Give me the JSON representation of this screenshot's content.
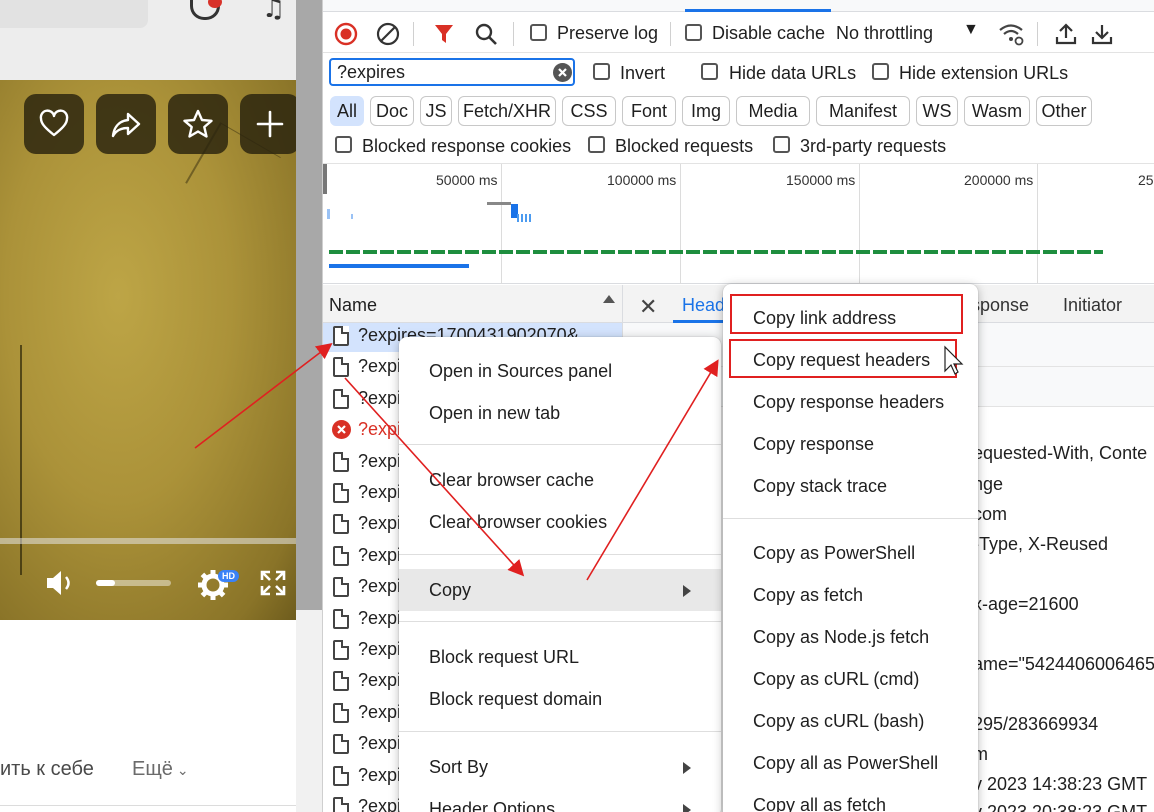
{
  "page": {
    "save_text": "ить к себе",
    "more_text": "Ещё",
    "video_quality_badge": "HD",
    "volume_fraction": 0.25
  },
  "devtools": {
    "toolbar": {
      "preserve_log": "Preserve log",
      "disable_cache": "Disable cache",
      "throttling": "No throttling"
    },
    "filter": {
      "value": "?expires",
      "invert": "Invert",
      "hide_data_urls": "Hide data URLs",
      "hide_extension_urls": "Hide extension URLs"
    },
    "type_filters": [
      "All",
      "Doc",
      "JS",
      "Fetch/XHR",
      "CSS",
      "Font",
      "Img",
      "Media",
      "Manifest",
      "WS",
      "Wasm",
      "Other"
    ],
    "block_filters": {
      "blocked_response_cookies": "Blocked response cookies",
      "blocked_requests": "Blocked requests",
      "third_party": "3rd-party requests"
    },
    "overview_ticks": [
      "50000 ms",
      "100000 ms",
      "150000 ms",
      "200000 ms",
      "25"
    ],
    "name_column": "Name",
    "requests": [
      {
        "name": "?expires=1700431902070&",
        "selected": true,
        "error": false
      },
      {
        "name": "?expir",
        "selected": false,
        "error": false
      },
      {
        "name": "?expir",
        "selected": false,
        "error": false
      },
      {
        "name": "?expir",
        "selected": false,
        "error": true
      },
      {
        "name": "?expir",
        "selected": false,
        "error": false
      },
      {
        "name": "?expir",
        "selected": false,
        "error": false
      },
      {
        "name": "?expir",
        "selected": false,
        "error": false
      },
      {
        "name": "?expir",
        "selected": false,
        "error": false
      },
      {
        "name": "?expir",
        "selected": false,
        "error": false
      },
      {
        "name": "?expir",
        "selected": false,
        "error": false
      },
      {
        "name": "?expir",
        "selected": false,
        "error": false
      },
      {
        "name": "?expir",
        "selected": false,
        "error": false
      },
      {
        "name": "?expir",
        "selected": false,
        "error": false
      },
      {
        "name": "?expir",
        "selected": false,
        "error": false
      },
      {
        "name": "?expir",
        "selected": false,
        "error": false
      },
      {
        "name": "?expir",
        "selected": false,
        "error": false
      }
    ],
    "detail_tabs": {
      "headers": "Head",
      "response": "sponse",
      "initiator": "Initiator"
    },
    "header_fragments": [
      "equested-With, Conte",
      "nge",
      "com",
      "-Type, X-Reused",
      "x-age=21600",
      "ame=\"5424406006465",
      "295/283669934",
      "m",
      "v 2023 14:38:23 GMT",
      "v 2023 20:38:23 GMT"
    ]
  },
  "context_menu": {
    "items": [
      {
        "label": "Open in Sources panel",
        "submenu": false
      },
      {
        "label": "Open in new tab",
        "submenu": false
      },
      {
        "label": "Clear browser cache",
        "submenu": false
      },
      {
        "label": "Clear browser cookies",
        "submenu": false
      },
      {
        "label": "Copy",
        "submenu": true
      },
      {
        "label": "Block request URL",
        "submenu": false
      },
      {
        "label": "Block request domain",
        "submenu": false
      },
      {
        "label": "Sort By",
        "submenu": true
      },
      {
        "label": "Header Options",
        "submenu": true
      }
    ]
  },
  "copy_submenu": {
    "items": [
      "Copy link address",
      "Copy request headers",
      "Copy response headers",
      "Copy response",
      "Copy stack trace",
      "Copy as PowerShell",
      "Copy as fetch",
      "Copy as Node.js fetch",
      "Copy as cURL (cmd)",
      "Copy as cURL (bash)",
      "Copy all as PowerShell",
      "Copy all as fetch"
    ],
    "highlighted": [
      "Copy link address",
      "Copy request headers"
    ]
  },
  "colors": {
    "accent": "#1a73e8",
    "record_red": "#d93025",
    "annotation_red": "#e02020",
    "waterfall_green": "#1e8e3e"
  }
}
